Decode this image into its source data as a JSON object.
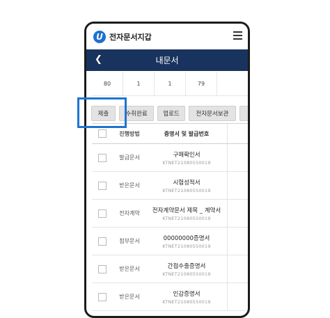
{
  "app": {
    "title": "전자문서지갑",
    "logo_letter": "U"
  },
  "nav": {
    "page_title": "내문서"
  },
  "counts": [
    "80",
    "1",
    "1",
    "79",
    ""
  ],
  "buttons": [
    "제출",
    "수취완료",
    "업로드",
    "전자문서보관",
    ""
  ],
  "table": {
    "headers": {
      "method": "진행방법",
      "doc": "증명서 및 발급번호"
    },
    "rows": [
      {
        "method": "발급문서",
        "name": "구매확인서",
        "no": "KTNET21080550019"
      },
      {
        "method": "받은문서",
        "name": "시험성적서",
        "no": "KTNET21080550019"
      },
      {
        "method": "전자계약",
        "name": "전자계약문서 제목 _ 계약서",
        "no": "KTNET21080550019"
      },
      {
        "method": "첨부문서",
        "name": "00000000증명서",
        "no": "KTNET21080550019"
      },
      {
        "method": "받은문서",
        "name": "간접수출증명서",
        "no": "KTNET21080550019"
      },
      {
        "method": "받은문서",
        "name": "인감증명서",
        "no": "KTNET21080550019"
      }
    ]
  },
  "colors": {
    "navbar": "#18335e",
    "highlight": "#1f74d1",
    "logo": "#1f6fd1"
  },
  "icons": {
    "back": "chevron-left-icon",
    "menu": "hamburger-menu-icon"
  }
}
